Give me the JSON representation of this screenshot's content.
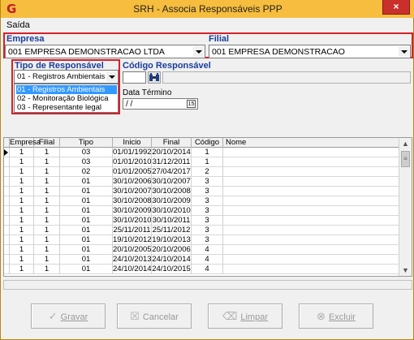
{
  "window": {
    "title": "SRH - Associa Responsáveis PPP",
    "close_glyph": "×",
    "app_glyph": "G"
  },
  "menu": {
    "items": [
      {
        "label": "Saída"
      }
    ]
  },
  "empresa": {
    "label": "Empresa",
    "value": "001 EMPRESA DEMONSTRACAO LTDA"
  },
  "filial": {
    "label": "Filial",
    "value": "001 EMPRESA DEMONSTRACAO"
  },
  "tipo_responsavel": {
    "label": "Tipo de Responsável",
    "value": "01 - Registros Ambientais",
    "options": [
      {
        "label": "01 - Registros Ambientais",
        "selected": true
      },
      {
        "label": "02 - Monitoração Biológica",
        "selected": false
      },
      {
        "label": "03 - Representante legal",
        "selected": false
      }
    ]
  },
  "codigo_responsavel": {
    "label": "Código Responsável",
    "value": ""
  },
  "data_termino": {
    "label": "Data Término",
    "value": " / /",
    "calendar_glyph": "15"
  },
  "grid": {
    "columns": [
      "Empresa",
      "Filial",
      "Tipo",
      "Inicio",
      "Final",
      "Código",
      "Nome"
    ],
    "rows": [
      [
        "1",
        "1",
        "03",
        "01/01/1992",
        "20/10/2014",
        "1",
        ""
      ],
      [
        "1",
        "1",
        "03",
        "01/01/2010",
        "31/12/2011",
        "1",
        ""
      ],
      [
        "1",
        "1",
        "02",
        "01/01/2005",
        "27/04/2017",
        "2",
        ""
      ],
      [
        "1",
        "1",
        "01",
        "30/10/2006",
        "30/10/2007",
        "3",
        ""
      ],
      [
        "1",
        "1",
        "01",
        "30/10/2007",
        "30/10/2008",
        "3",
        ""
      ],
      [
        "1",
        "1",
        "01",
        "30/10/2008",
        "30/10/2009",
        "3",
        ""
      ],
      [
        "1",
        "1",
        "01",
        "30/10/2009",
        "30/10/2010",
        "3",
        ""
      ],
      [
        "1",
        "1",
        "01",
        "30/10/2010",
        "30/10/2011",
        "3",
        ""
      ],
      [
        "1",
        "1",
        "01",
        "25/11/2011",
        "25/11/2012",
        "3",
        ""
      ],
      [
        "1",
        "1",
        "01",
        "19/10/2012",
        "19/10/2013",
        "3",
        ""
      ],
      [
        "1",
        "1",
        "01",
        "20/10/2005",
        "20/10/2006",
        "4",
        ""
      ],
      [
        "1",
        "1",
        "01",
        "24/10/2013",
        "24/10/2014",
        "4",
        ""
      ],
      [
        "1",
        "1",
        "01",
        "24/10/2014",
        "24/10/2015",
        "4",
        ""
      ]
    ]
  },
  "buttons": {
    "gravar": {
      "label": "Gravar",
      "icon": "check-icon"
    },
    "cancelar": {
      "label": "Cancelar",
      "icon": "cancel-icon"
    },
    "limpar": {
      "label": "Limpar",
      "icon": "eraser-icon"
    },
    "excluir": {
      "label": "Excluir",
      "icon": "delete-icon"
    }
  },
  "colors": {
    "title_bar": "#f6bd3e",
    "highlight_box": "#d6202a",
    "label_blue": "#1a3e9a",
    "selection": "#3399ff"
  }
}
